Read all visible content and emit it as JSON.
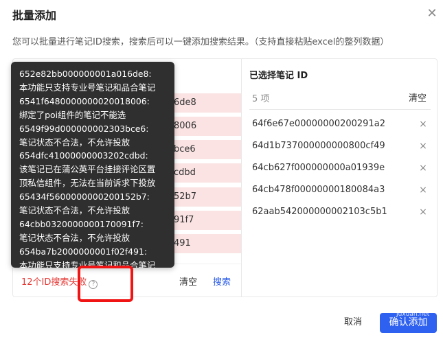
{
  "dialog": {
    "title": "批量添加",
    "close_icon": "close-icon",
    "description": "您可以批量进行笔记ID搜索，搜索后可以一键添加搜索结果。（支持直接粘贴excel的整列数据）"
  },
  "left": {
    "id_rows": [
      {
        "text": "6de8"
      },
      {
        "text": "8006"
      },
      {
        "text": "bce6"
      },
      {
        "text": "cdbd"
      },
      {
        "text": "52b7"
      },
      {
        "text": "91f7"
      },
      {
        "text": "491"
      }
    ],
    "fail_text": "12个ID搜索失败",
    "help_icon": "question-circle-icon",
    "clear_label": "清空",
    "search_label": "搜索"
  },
  "tooltip": {
    "lines": [
      "652e82bb000000001a016de8:",
      "本功能只支持专业号笔记和品合笔记",
      "6541f6480000000020018006:",
      "绑定了poi组件的笔记不能选",
      "6549f99d000000002303bce6:",
      "笔记状态不合法，不允许投放",
      "654dfc41000000003202cdbd:",
      "该笔记已在蒲公英平台挂接评论区置",
      "顶私信组件，无法在当前诉求下投放",
      "65434f5600000000200152b7:",
      "笔记状态不合法，不允许投放",
      "64cbb0320000000170091f7:",
      "笔记状态不合法，不允许投放",
      "654ba7b2000000001f02f491:",
      "本功能只支持专业号笔记和品合笔记"
    ]
  },
  "right": {
    "title": "已选择笔记 ID",
    "count": "5 项",
    "clear_label": "清空",
    "remove_icon": "close-icon",
    "items": [
      {
        "id": "64f6e67e00000000200291a2",
        "remove": "×"
      },
      {
        "id": "64d1b737000000000800cf49",
        "remove": "×"
      },
      {
        "id": "64cb627f000000000a01939e",
        "remove": "×"
      },
      {
        "id": "64cb478f00000000180084a3",
        "remove": "×"
      },
      {
        "id": "62aab542000000002103c5b1",
        "remove": "×"
      }
    ]
  },
  "footer": {
    "cancel_label": "取消",
    "confirm_label": "确认添加",
    "watermark": "Juxuan.net"
  },
  "colors": {
    "primary": "#2e61f0",
    "error": "#e53935",
    "annotation": "#f01414",
    "error_row_bg": "#fbe3e3",
    "tooltip_bg": "#2f2f2f"
  }
}
